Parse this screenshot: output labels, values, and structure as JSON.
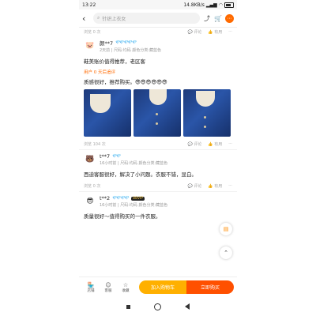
{
  "status": {
    "time": "13:22",
    "net": "14.8KB/s",
    "battery": ""
  },
  "search": {
    "placeholder": "针织上衣女"
  },
  "top_actions": {
    "views": "浏览 0 次",
    "comment": "评论",
    "useful": "有用",
    "more": "···"
  },
  "reviews": [
    {
      "name": "颜**7",
      "meta": "2天前 | 尺码:均码 颜色分类:藏蓝色",
      "text": "鞋美账价值得推荐，老区客",
      "append": "用户 0 天后追评",
      "text2": "质感很好，推荐购买。😎😎😎😎😎😎",
      "views": "浏览 104 次",
      "comment": "评论",
      "useful": "有用",
      "more": "···"
    },
    {
      "name": "t**7",
      "meta": "16小时前 | 尺码:均码 颜色分类:藏蓝色",
      "text": "西迪客服很好，解决了小问题。衣服不错，显白。",
      "views": "浏览 0 次",
      "comment": "评论",
      "useful": "有用",
      "more": "···"
    },
    {
      "name": "t**2",
      "vip": "88VIP",
      "meta": "16小时前 | 尺码:均码 颜色分类:藏蓝色",
      "text": "质量很好～值得购买的一件衣服。"
    }
  ],
  "bottom": {
    "shop": "店铺",
    "service": "客服",
    "fav": "收藏",
    "add_cart": "加入购物车",
    "buy_now": "立即购买"
  },
  "colors": {
    "accent": "#ff5000",
    "cart": "#ffb000",
    "diamond": "#39a7ff"
  }
}
